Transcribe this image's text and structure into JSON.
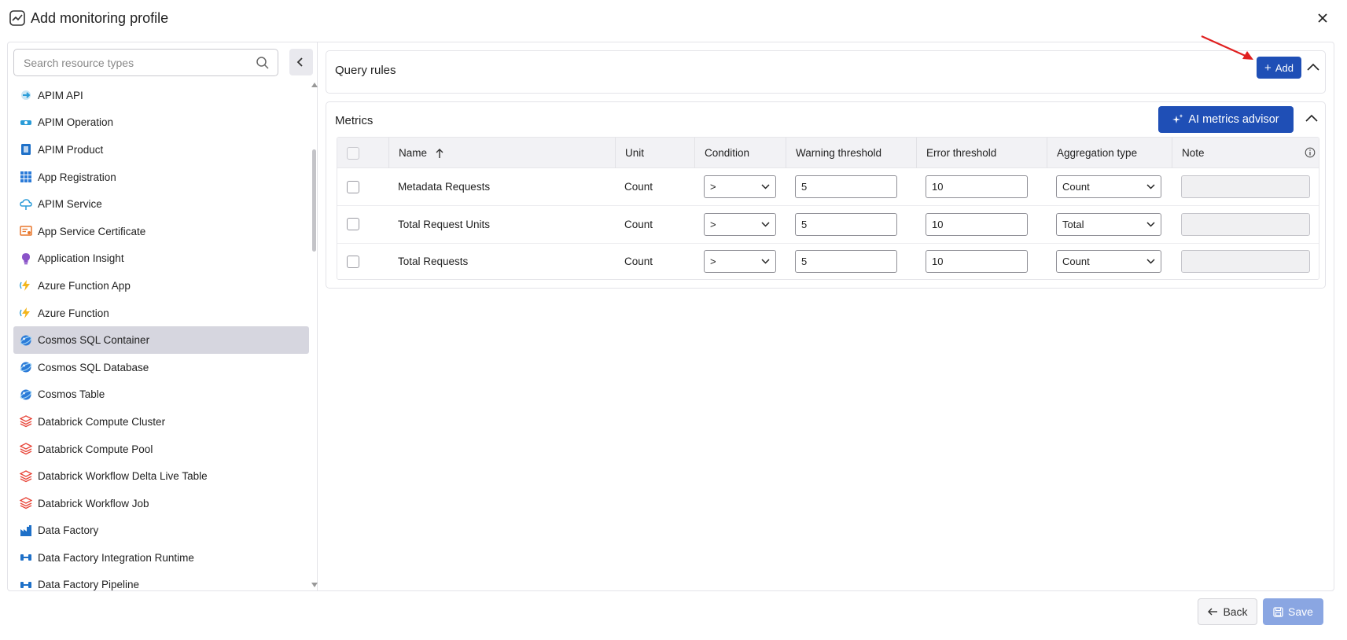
{
  "dialog": {
    "title": "Add monitoring profile",
    "title_icon": "chart-line-icon",
    "close_icon": "close-icon"
  },
  "sidebar": {
    "search": {
      "placeholder": "Search resource types",
      "value": ""
    },
    "items": [
      {
        "label": "APIM API",
        "icon": "apim-api-icon",
        "color": "#2b9cd8"
      },
      {
        "label": "APIM Operation",
        "icon": "apim-operation-icon",
        "color": "#2b9cd8"
      },
      {
        "label": "APIM Product",
        "icon": "apim-product-icon",
        "color": "#1e70c8"
      },
      {
        "label": "App Registration",
        "icon": "app-registration-icon",
        "color": "#2b7bd8"
      },
      {
        "label": "APIM Service",
        "icon": "apim-service-icon",
        "color": "#2b9cd8"
      },
      {
        "label": "App Service Certificate",
        "icon": "certificate-icon",
        "color": "#e8762b"
      },
      {
        "label": "Application Insight",
        "icon": "application-insight-icon",
        "color": "#8a53c8"
      },
      {
        "label": "Azure Function App",
        "icon": "function-app-icon",
        "color": "#f3b51c"
      },
      {
        "label": "Azure Function",
        "icon": "function-icon",
        "color": "#f3b51c"
      },
      {
        "label": "Cosmos SQL Container",
        "icon": "cosmos-icon",
        "color": "#2b7bd8",
        "selected": true
      },
      {
        "label": "Cosmos SQL Database",
        "icon": "cosmos-icon",
        "color": "#2b7bd8"
      },
      {
        "label": "Cosmos Table",
        "icon": "cosmos-icon",
        "color": "#2b7bd8"
      },
      {
        "label": "Databrick Compute Cluster",
        "icon": "databricks-icon",
        "color": "#e8473b"
      },
      {
        "label": "Databrick Compute Pool",
        "icon": "databricks-icon",
        "color": "#e8473b"
      },
      {
        "label": "Databrick Workflow Delta Live Table",
        "icon": "databricks-icon",
        "color": "#e8473b"
      },
      {
        "label": "Databrick Workflow Job",
        "icon": "databricks-icon",
        "color": "#e8473b"
      },
      {
        "label": "Data Factory",
        "icon": "data-factory-icon",
        "color": "#1e70c8"
      },
      {
        "label": "Data Factory Integration Runtime",
        "icon": "data-factory-runtime-icon",
        "color": "#1e70c8"
      },
      {
        "label": "Data Factory Pipeline",
        "icon": "data-factory-pipeline-icon",
        "color": "#1e70c8"
      }
    ]
  },
  "query_rules": {
    "title": "Query rules",
    "add_label": "Add"
  },
  "metrics": {
    "title": "Metrics",
    "ai_label": "AI metrics advisor",
    "columns": [
      "Name",
      "Unit",
      "Condition",
      "Warning threshold",
      "Error threshold",
      "Aggregation type",
      "Note"
    ],
    "rows": [
      {
        "name": "Metadata Requests",
        "unit": "Count",
        "condition": ">",
        "warning": "5",
        "error": "10",
        "aggregation": "Count",
        "note": ""
      },
      {
        "name": "Total Request Units",
        "unit": "Count",
        "condition": ">",
        "warning": "5",
        "error": "10",
        "aggregation": "Total",
        "note": ""
      },
      {
        "name": "Total Requests",
        "unit": "Count",
        "condition": ">",
        "warning": "5",
        "error": "10",
        "aggregation": "Count",
        "note": ""
      }
    ]
  },
  "footer": {
    "back_label": "Back",
    "save_label": "Save"
  },
  "colors": {
    "primary": "#1f4fb6",
    "save_disabled": "#8aa6e2",
    "selected_row": "#d6d6df",
    "annotation_arrow": "#e02020"
  }
}
